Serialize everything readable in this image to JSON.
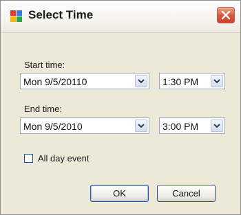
{
  "window": {
    "title": "Select Time",
    "close_icon": "close-icon"
  },
  "start": {
    "label": "Start time:",
    "date": "Mon 9/5/20110",
    "time": "1:30 PM"
  },
  "end": {
    "label": "End time:",
    "date": "Mon 9/5/2010",
    "time": "3:00 PM"
  },
  "all_day": {
    "label": "All day event",
    "checked": false
  },
  "buttons": {
    "ok": "OK",
    "cancel": "Cancel"
  },
  "colors": {
    "dialog_bg": "#ece9d8",
    "close_button": "#d9543a"
  }
}
